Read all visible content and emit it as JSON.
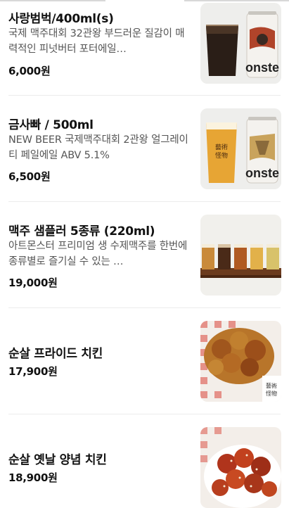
{
  "menu": {
    "items": [
      {
        "name": "사랑범벅/400ml(s)",
        "description": "국제 맥주대회 32관왕 부드러운 질감이 매력적인 피넛버터 포터에일…",
        "price": "6,000원",
        "image_icon": "porter-beer-glass-and-can"
      },
      {
        "name": "금사빠 / 500ml",
        "description": "NEW BEER 국제맥주대회 2관왕 얼그레이 티 페일에일 ABV 5.1%",
        "price": "6,500원",
        "image_icon": "pale-ale-glass-and-can"
      },
      {
        "name": "맥주 샘플러 5종류 (220ml)",
        "description": "아트몬스터 프리미엄 생 수제맥주를 한번에 종류별로 즐기실 수 있는 …",
        "price": "19,000원",
        "image_icon": "beer-sampler-flight"
      },
      {
        "name": "순살 프라이드 치킨",
        "description": "",
        "price": "17,900원",
        "image_icon": "fried-chicken-plate"
      },
      {
        "name": "순살 옛날 양념 치킨",
        "description": "",
        "price": "18,900원",
        "image_icon": "seasoned-chicken-plate"
      }
    ]
  },
  "images": {
    "can_text": "onste",
    "glass_text": "藝術\n怪物"
  },
  "colors": {
    "price": "#111111",
    "description": "#555555",
    "divider": "#ececec"
  }
}
